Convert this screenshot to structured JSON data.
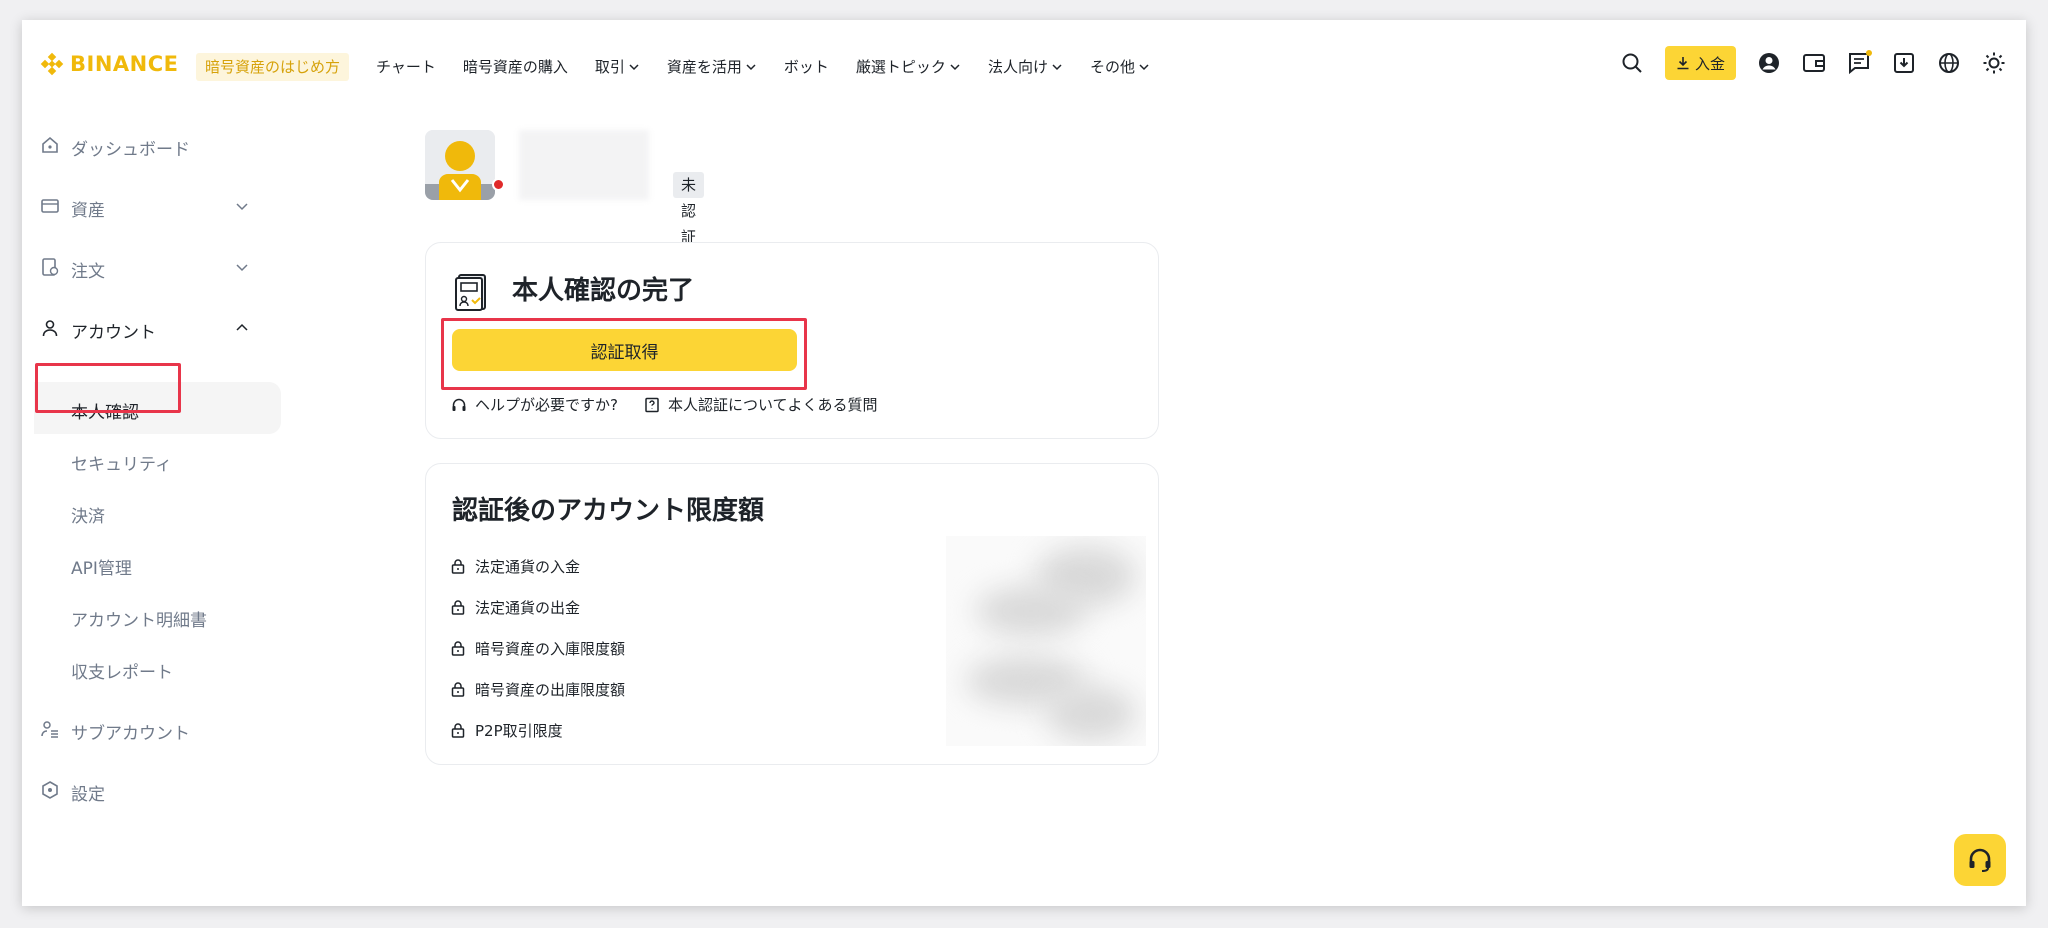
{
  "header": {
    "logo_text": "BINANCE",
    "promo": "暗号資産のはじめ方",
    "nav": [
      {
        "label": "チャート",
        "dropdown": false
      },
      {
        "label": "暗号資産の購入",
        "dropdown": false
      },
      {
        "label": "取引",
        "dropdown": true
      },
      {
        "label": "資産を活用",
        "dropdown": true
      },
      {
        "label": "ボット",
        "dropdown": false
      },
      {
        "label": "厳選トピック",
        "dropdown": true
      },
      {
        "label": "法人向け",
        "dropdown": true
      },
      {
        "label": "その他",
        "dropdown": true
      }
    ],
    "deposit_label": "入金",
    "icons": [
      "search-icon",
      "download-icon",
      "user-icon",
      "wallet-icon",
      "message-icon",
      "app-download-icon",
      "globe-icon",
      "theme-sun-icon"
    ]
  },
  "sidebar": {
    "items": [
      {
        "label": "ダッシュボード",
        "icon": "dashboard-icon"
      },
      {
        "label": "資産",
        "icon": "wallet-icon"
      },
      {
        "label": "注文",
        "icon": "orders-icon"
      },
      {
        "label": "アカウント",
        "icon": "account-icon"
      }
    ],
    "account_sub": [
      {
        "label": "本人確認"
      },
      {
        "label": "セキュリティ"
      },
      {
        "label": "決済"
      },
      {
        "label": "API管理"
      },
      {
        "label": "アカウント明細書"
      },
      {
        "label": "収支レポート"
      }
    ],
    "more": [
      {
        "label": "サブアカウント",
        "icon": "sub-account-icon"
      },
      {
        "label": "設定",
        "icon": "settings-icon"
      }
    ]
  },
  "profile": {
    "status_badge": "未認証"
  },
  "verify_card": {
    "title": "本人確認の完了",
    "button": "認証取得",
    "help_link": "ヘルプが必要ですか?",
    "faq_link": "本人認証についてよくある質問"
  },
  "limits_card": {
    "title": "認証後のアカウント限度額",
    "items": [
      "法定通貨の入金",
      "法定通貨の出金",
      "暗号資産の入庫限度額",
      "暗号資産の出庫限度額",
      "P2P取引限度"
    ]
  },
  "colors": {
    "brand_yellow": "#f0b90b",
    "button_yellow": "#fcd535",
    "highlight_red": "#e8354a",
    "status_red": "#e02a2a"
  }
}
